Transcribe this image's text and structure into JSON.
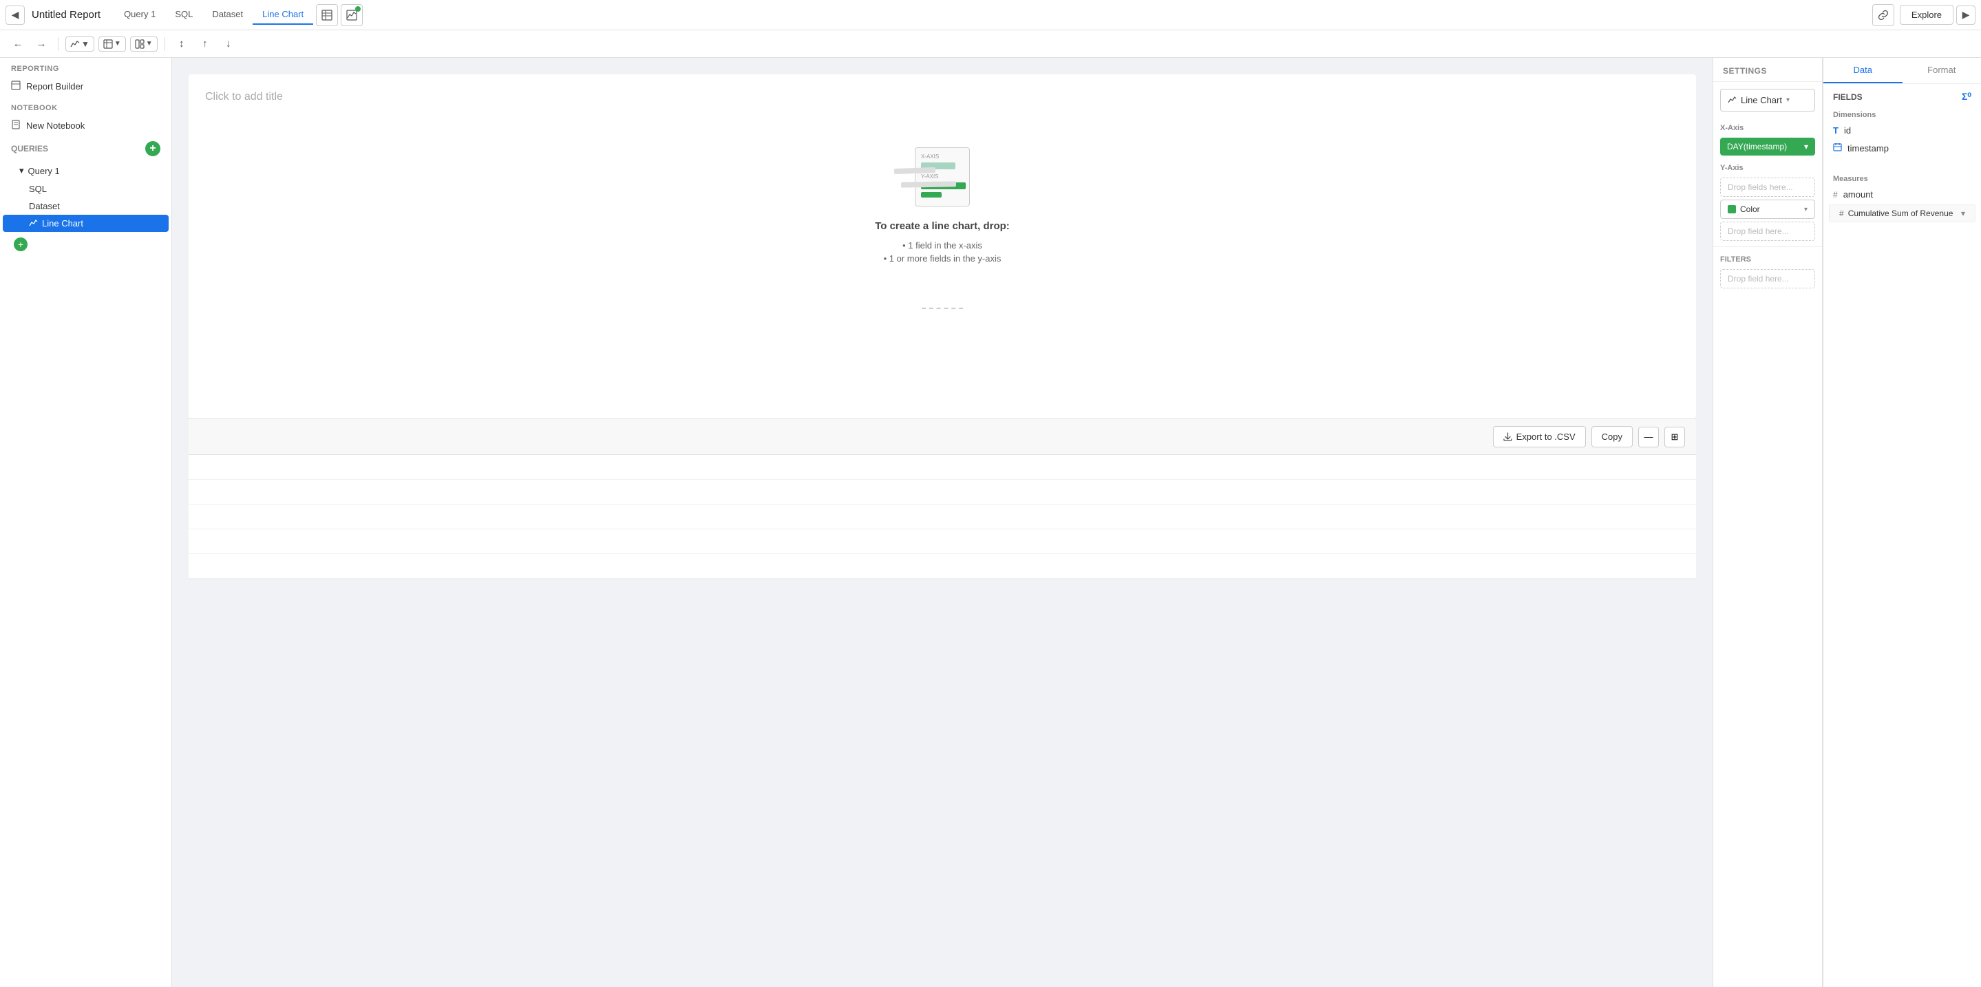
{
  "topbar": {
    "back_icon": "◀",
    "report_title": "Untitled Report",
    "tabs": [
      {
        "id": "query1",
        "label": "Query 1",
        "active": false
      },
      {
        "id": "sql",
        "label": "SQL",
        "active": false
      },
      {
        "id": "dataset",
        "label": "Dataset",
        "active": false
      },
      {
        "id": "linechart",
        "label": "Line Chart",
        "active": true
      }
    ],
    "explore_label": "Explore",
    "link_icon": "🔗",
    "forward_icon": "▶"
  },
  "toolbar2": {
    "back_arrow": "←",
    "forward_arrow": "→",
    "chart_icon": "📊",
    "table_icon": "⊞",
    "layout_icon": "⊡",
    "align_icons": [
      "↕",
      "↑",
      "↓"
    ]
  },
  "sidebar": {
    "reporting_label": "REPORTING",
    "report_builder_label": "Report Builder",
    "notebook_label": "NOTEBOOK",
    "new_notebook_label": "New Notebook",
    "queries_label": "QUERIES",
    "add_icon": "+",
    "queries": [
      {
        "label": "Query 1",
        "chevron": "▾",
        "children": [
          {
            "label": "SQL"
          },
          {
            "label": "Dataset"
          },
          {
            "label": "Line Chart",
            "active": true
          }
        ]
      }
    ],
    "add_sub_icon": "+"
  },
  "canvas": {
    "title_placeholder": "Click to add title",
    "chart_instructions": {
      "heading": "To create a line chart, drop:",
      "line1": "• 1 field in the x-axis",
      "line2": "• 1 or more fields in the y-axis"
    },
    "xaxis_label": "X-AXIS",
    "yaxis_label": "Y-AXIS"
  },
  "bottom_toolbar": {
    "export_label": "Export to .CSV",
    "copy_label": "Copy",
    "minimize_icon": "—",
    "expand_icon": "⊞"
  },
  "settings": {
    "header_label": "SETTINGS",
    "chart_type": "Line Chart",
    "xaxis_label": "X-Axis",
    "xaxis_value": "DAY(timestamp)",
    "yaxis_label": "Y-Axis",
    "yaxis_placeholder": "Drop fields here...",
    "color_label": "Color",
    "color_value": "Color",
    "color_placeholder": "Drop field here...",
    "filters_label": "FILTERS",
    "filters_placeholder": "Drop field here..."
  },
  "fields_panel": {
    "data_tab": "Data",
    "format_tab": "Format",
    "fields_label": "FIELDS",
    "dimensions_label": "Dimensions",
    "dimension_items": [
      {
        "type": "T",
        "name": "id"
      },
      {
        "type": "cal",
        "name": "timestamp"
      }
    ],
    "measures_label": "Measures",
    "measure_items": [
      {
        "type": "#",
        "name": "amount"
      },
      {
        "type": "#",
        "name": "Cumulative Sum of Revenue",
        "expandable": true
      }
    ]
  }
}
